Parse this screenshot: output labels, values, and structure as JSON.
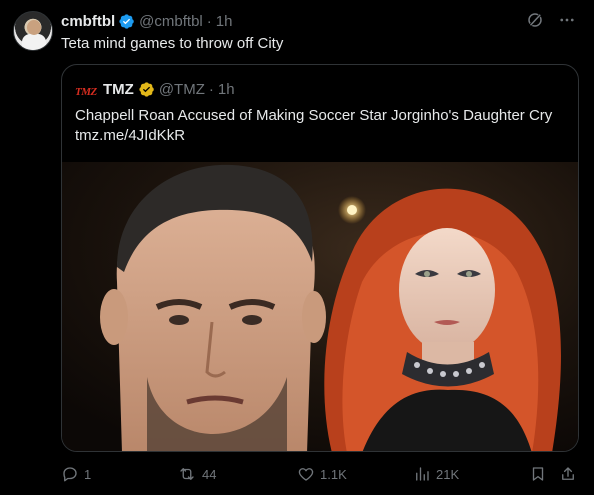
{
  "tweet": {
    "display_name": "cmbftbl",
    "handle": "@cmbftbl",
    "separator": "·",
    "time": "1h",
    "text": "Teta mind games to throw off City"
  },
  "quote": {
    "logo_text": "TMZ",
    "display_name": "TMZ",
    "handle": "@TMZ",
    "separator": "·",
    "time": "1h",
    "headline": "Chappell Roan Accused of Making Soccer Star Jorginho's Daughter Cry",
    "link": "tmz.me/4JIdKkR"
  },
  "actions": {
    "replies": "1",
    "reposts": "44",
    "likes": "1.1K",
    "views": "21K"
  },
  "colors": {
    "background": "#000000",
    "text": "#e7e9ea",
    "muted": "#71767b",
    "verified_blue": "#1d9bf0",
    "verified_gold": "#e2b719",
    "border": "#2f3336"
  },
  "icons": {
    "verified": "verified-badge-icon",
    "gold_verified": "gold-verified-badge-icon",
    "grok": "grok-icon",
    "more": "more-icon",
    "reply": "reply-icon",
    "repost": "repost-icon",
    "like": "like-icon",
    "views": "views-icon",
    "bookmark": "bookmark-icon",
    "share": "share-icon"
  }
}
